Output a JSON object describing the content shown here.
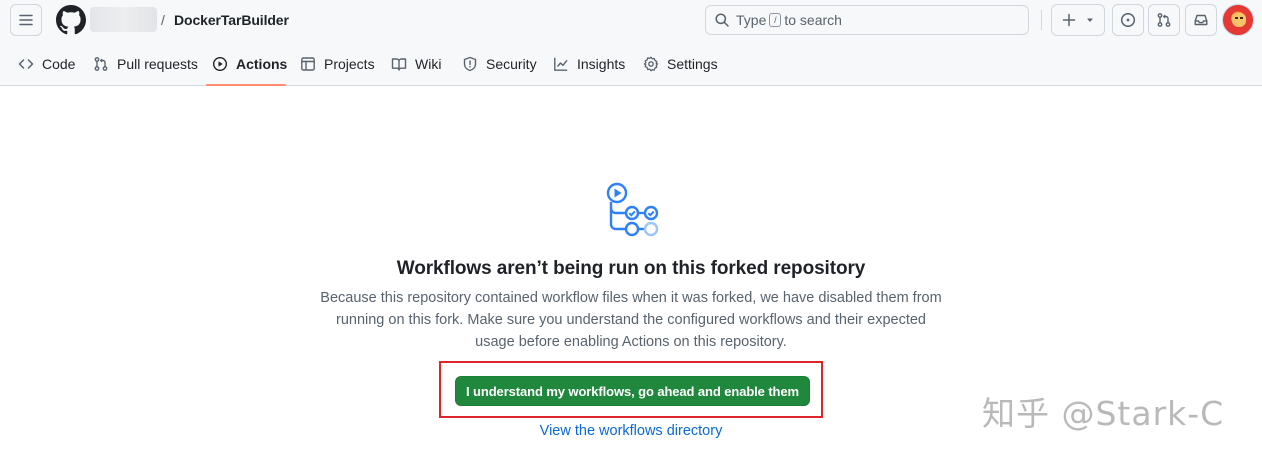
{
  "header": {
    "repo_separator": "/",
    "repo_name": "DockerTarBuilder",
    "search": {
      "prefix": "Type",
      "key": "/",
      "suffix": "to search"
    }
  },
  "tabs": [
    {
      "label": "Code",
      "icon": "code-icon"
    },
    {
      "label": "Pull requests",
      "icon": "git-pull-request-icon"
    },
    {
      "label": "Actions",
      "icon": "play-icon",
      "active": true
    },
    {
      "label": "Projects",
      "icon": "table-icon"
    },
    {
      "label": "Wiki",
      "icon": "book-icon"
    },
    {
      "label": "Security",
      "icon": "shield-icon"
    },
    {
      "label": "Insights",
      "icon": "graph-icon"
    },
    {
      "label": "Settings",
      "icon": "gear-icon"
    }
  ],
  "main": {
    "title": "Workflows aren’t being run on this forked repository",
    "description_lines": [
      "Because this repository contained workflow files when it was forked, we have disabled them from",
      "running on this fork. Make sure you understand the configured workflows and their expected",
      "usage before enabling Actions on this repository."
    ],
    "enable_button": "I understand my workflows, go ahead and enable them",
    "directory_link": "View the workflows directory"
  },
  "watermark": "知乎 @Stark-C",
  "colors": {
    "accent_green": "#1f883d",
    "link_blue": "#0969da",
    "tab_underline": "#fd8c73",
    "highlight_red": "#e0242b"
  }
}
